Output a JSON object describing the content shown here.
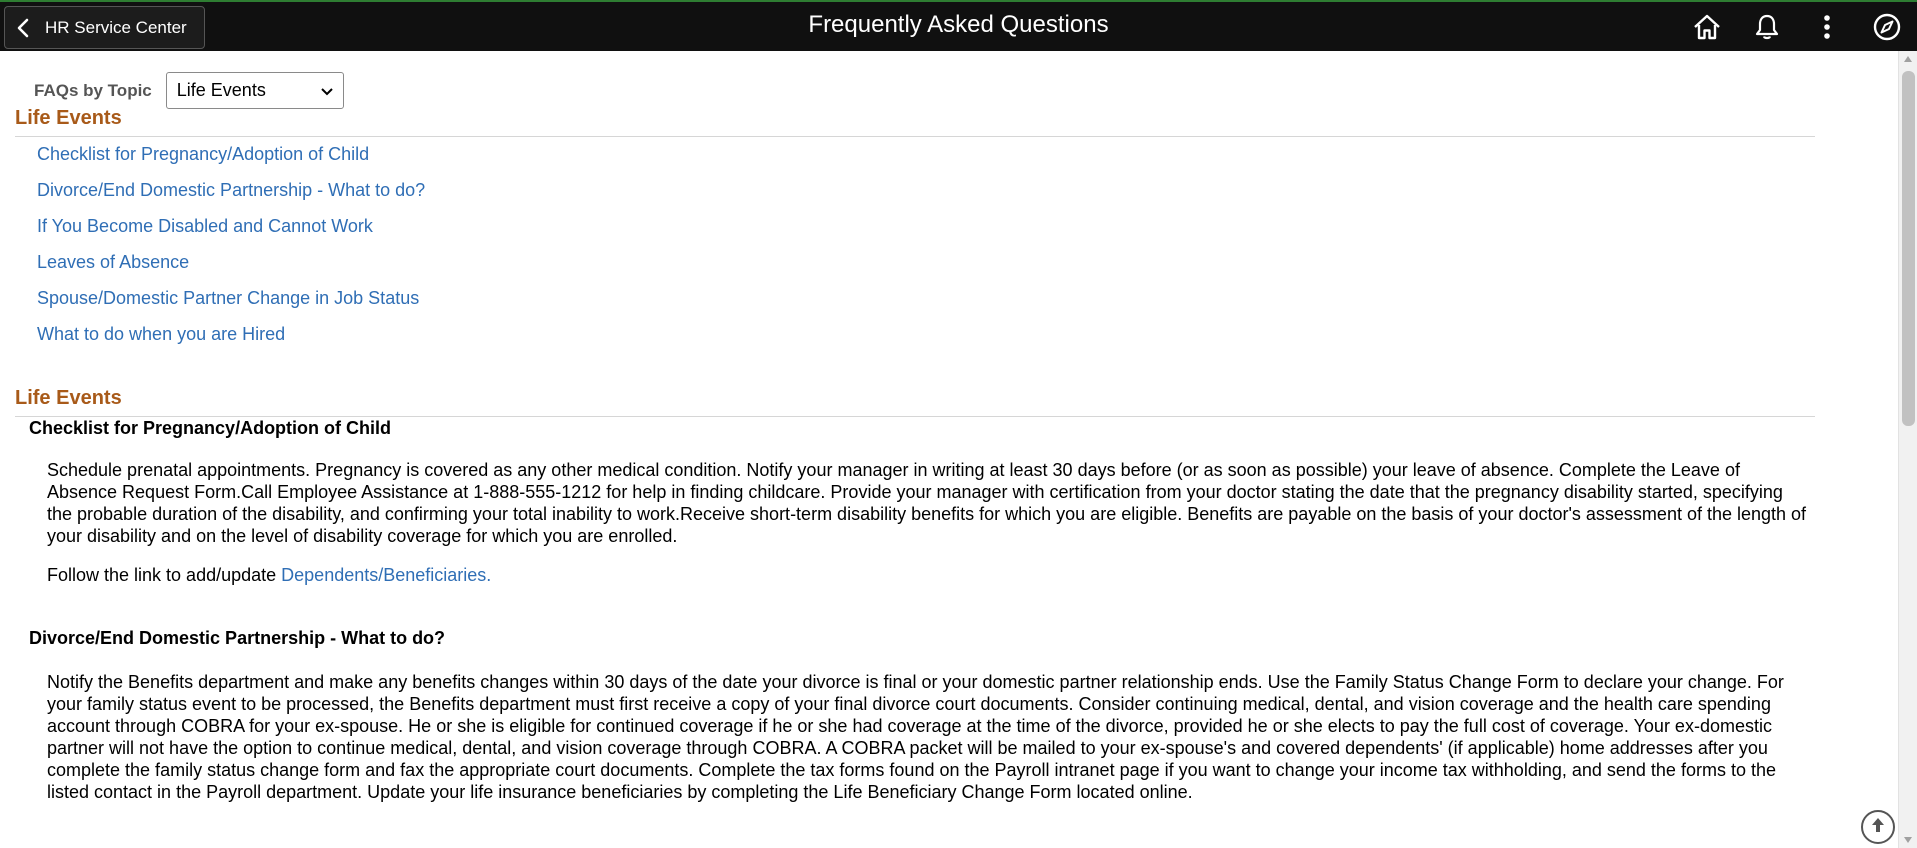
{
  "header": {
    "back_label": "HR Service Center",
    "title": "Frequently Asked Questions",
    "icons": [
      "home-icon",
      "notification-bell-icon",
      "actions-menu-icon",
      "navbar-compass-icon"
    ]
  },
  "filter": {
    "label": "FAQs by Topic",
    "selected": "Life Events"
  },
  "toc": {
    "heading": "Life Events",
    "links": [
      "Checklist for Pregnancy/Adoption of Child",
      "Divorce/End Domestic Partnership - What to do?",
      "If You Become Disabled and Cannot Work",
      "Leaves of Absence",
      "Spouse/Domestic Partner Change in Job Status",
      "What to do when you are Hired"
    ]
  },
  "details": {
    "heading": "Life Events",
    "articles": [
      {
        "title": "Checklist for Pregnancy/Adoption of Child",
        "body": "Schedule prenatal appointments. Pregnancy is covered as any other medical condition. Notify your manager in writing at least 30 days before (or as soon as possible) your leave of absence. Complete the Leave of Absence Request Form.Call Employee Assistance at 1-888-555-1212 for help in finding childcare. Provide your manager with certification from your doctor stating the date that the pregnancy disability started, specifying the probable duration of the disability, and confirming your total inability to work.Receive short-term disability benefits for which you are eligible. Benefits are payable on the basis of your doctor's assessment of the length of your disability and on the level of disability coverage for which you are enrolled.",
        "follow_prefix": "Follow the link to add/update ",
        "follow_link": "Dependents/Beneficiaries."
      },
      {
        "title": "Divorce/End Domestic Partnership - What to do?",
        "body": "Notify the Benefits department and make any benefits changes within 30 days of the date your divorce is final or your domestic partner relationship ends. Use the Family Status Change Form to declare your change. For your family status event to be processed, the Benefits department must first receive a copy of your final divorce court documents. Consider continuing medical, dental, and vision coverage and the health care spending account through COBRA for your ex-spouse. He or she is eligible for continued coverage if he or she had coverage at the time of the divorce, provided he or she elects to pay the full cost of coverage. Your ex-domestic partner will not have the option to continue medical, dental, and vision coverage through COBRA. A COBRA packet will be mailed to your ex-spouse's and covered dependents' (if applicable) home addresses after you complete the family status change form and fax the appropriate court documents. Complete the tax forms found on the Payroll intranet page if you want to change your income tax withholding, and send the forms to the listed contact in the Payroll department. Update your life insurance beneficiaries by completing the Life Beneficiary Change Form located online."
      }
    ]
  },
  "colors": {
    "header_bg": "#101010",
    "section_heading": "#a85a19",
    "link": "#2f6eb5"
  }
}
